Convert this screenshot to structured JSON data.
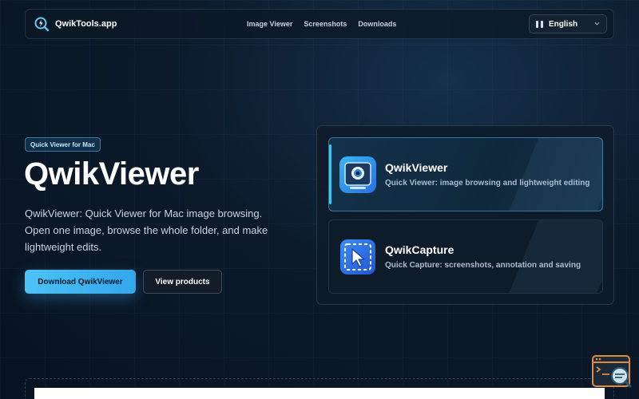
{
  "navbar": {
    "brand": "QwikTools.app",
    "links": [
      "Image Viewer",
      "Screenshots",
      "Downloads"
    ],
    "language": "English"
  },
  "hero": {
    "badge": "Quick Viewer for Mac",
    "title": "QwikViewer",
    "description": "QwikViewer: Quick Viewer for Mac image browsing. Open one image, browse the whole folder, and make lightweight edits.",
    "primary_button": "Download QwikViewer",
    "secondary_button": "View products"
  },
  "products": [
    {
      "name": "QwikViewer",
      "subtitle": "Quick Viewer: image browsing and lightweight editing",
      "icon": "eye-viewer-icon",
      "active": true
    },
    {
      "name": "QwikCapture",
      "subtitle": "Quick Capture: screenshots, annotation and saving",
      "icon": "capture-cursor-icon",
      "active": false
    }
  ],
  "colors": {
    "accent": "#3fc3f0",
    "background": "#0c1a2b",
    "primary_button": "#4cc3f5"
  }
}
